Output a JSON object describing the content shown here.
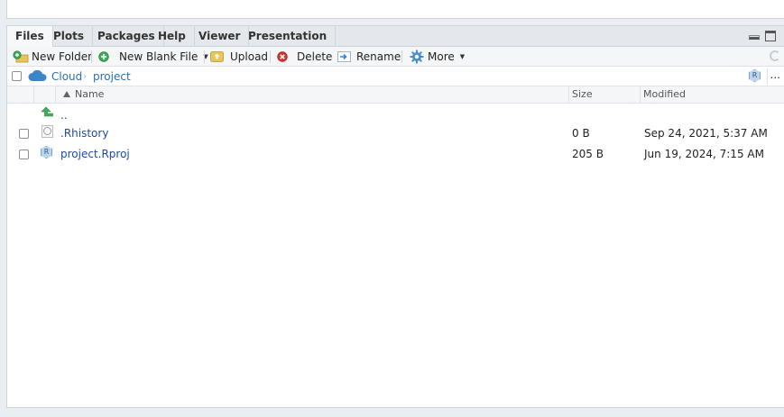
{
  "tabs": [
    {
      "label": "Files",
      "active": true
    },
    {
      "label": "Plots",
      "active": false
    },
    {
      "label": "Packages",
      "active": false
    },
    {
      "label": "Help",
      "active": false
    },
    {
      "label": "Viewer",
      "active": false
    },
    {
      "label": "Presentation",
      "active": false
    }
  ],
  "toolbar": {
    "new_folder": "New Folder",
    "new_blank_file": "New Blank File",
    "upload": "Upload",
    "delete": "Delete",
    "rename": "Rename",
    "more": "More"
  },
  "breadcrumb": {
    "root": "Cloud",
    "current": "project",
    "more": "..."
  },
  "columns": {
    "name": "Name",
    "size": "Size",
    "modified": "Modified"
  },
  "parent_dir": "..",
  "files": [
    {
      "name": ".Rhistory",
      "size": "0 B",
      "modified": "Sep 24, 2021, 5:37 AM",
      "icon": "rhistory-file-icon"
    },
    {
      "name": "project.Rproj",
      "size": "205 B",
      "modified": "Jun 19, 2024, 7:15 AM",
      "icon": "rproj-file-icon"
    }
  ],
  "colors": {
    "link": "#1f4aa3",
    "crumb": "#2a6fb0",
    "cloud": "#3a86c8",
    "pane_border": "#cfd5dc"
  }
}
